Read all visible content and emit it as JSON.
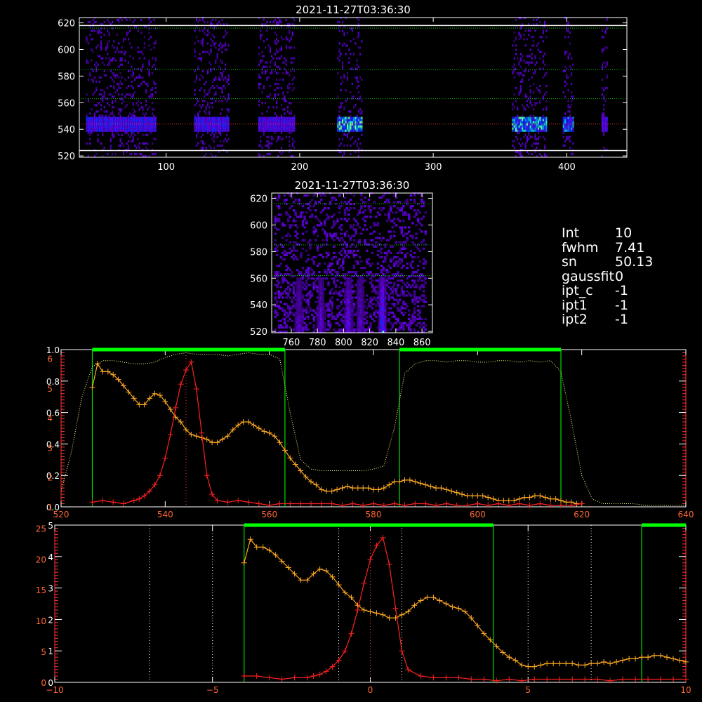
{
  "info_panel": {
    "rows": [
      {
        "key": "Int",
        "value": "10"
      },
      {
        "key": "fwhm",
        "value": "7.41"
      },
      {
        "key": "sn",
        "value": "50.13"
      },
      {
        "key": "gaussfit",
        "value": "0"
      },
      {
        "key": "ipt_c",
        "value": "-1"
      },
      {
        "key": "ipt1",
        "value": "-1"
      },
      {
        "key": "ipt2",
        "value": "-1"
      }
    ]
  },
  "colors": {
    "background": "#000000",
    "axes": "#ffffff",
    "line_yellow": "#ffaa22",
    "line_red": "#ff2020",
    "green": "#00ff00",
    "dotted_white": "#ffffff"
  },
  "chart_data": [
    {
      "id": "top-image",
      "type": "heatmap",
      "title": "2021-11-27T03:36:30",
      "xlim": [
        35,
        445
      ],
      "ylim": [
        519,
        624
      ],
      "xticks": [
        100,
        200,
        300,
        400
      ],
      "yticks": [
        520,
        540,
        560,
        580,
        600,
        620
      ],
      "hlines_dotted": [
        {
          "y": 616,
          "color": "#00cc00"
        },
        {
          "y": 585,
          "color": "#00cc00"
        },
        {
          "y": 563,
          "color": "#00cc00"
        },
        {
          "y": 544,
          "color": "#ff3333"
        }
      ],
      "hlines_solid": [
        618,
        524
      ],
      "bright_rows": [
        538,
        548
      ],
      "segments": [
        {
          "x0": 40,
          "x1": 92,
          "strength": 0.6
        },
        {
          "x0": 121,
          "x1": 147,
          "strength": 0.6
        },
        {
          "x0": 169,
          "x1": 196,
          "strength": 0.55
        },
        {
          "x0": 228,
          "x1": 247,
          "strength": 0.95
        },
        {
          "x0": 359,
          "x1": 385,
          "strength": 0.9
        },
        {
          "x0": 397,
          "x1": 405,
          "strength": 0.8
        },
        {
          "x0": 426,
          "x1": 430,
          "strength": 0.5
        }
      ]
    },
    {
      "id": "mid-image",
      "type": "heatmap",
      "title": "2021-11-27T03:36:30",
      "xlim": [
        745,
        868
      ],
      "ylim": [
        519,
        624
      ],
      "xticks": [
        760,
        780,
        800,
        820,
        840,
        860
      ],
      "yticks": [
        520,
        540,
        560,
        580,
        600,
        620
      ],
      "hlines_dotted": [
        {
          "y": 616,
          "color": "#00cc00"
        },
        {
          "y": 585,
          "color": "#00cc00"
        },
        {
          "y": 562,
          "color": "#00cc00"
        }
      ],
      "data_x_range": [
        747,
        862
      ],
      "bright_columns": [
        {
          "x": 765,
          "strength": 0.4
        },
        {
          "x": 782,
          "strength": 0.45
        },
        {
          "x": 803,
          "strength": 0.6
        },
        {
          "x": 812,
          "strength": 0.5
        },
        {
          "x": 829,
          "strength": 1.0
        }
      ]
    },
    {
      "id": "spectrum-wavelength",
      "type": "line",
      "xlim": [
        520,
        640
      ],
      "xticks": [
        520,
        540,
        560,
        580,
        600,
        620,
        640
      ],
      "left_ticks_white": [
        0.0,
        0.2,
        0.4,
        0.6,
        0.8,
        1.0
      ],
      "left_ticks_orange": [
        1,
        2,
        3,
        4,
        5,
        6
      ],
      "green_bars": [
        [
          526,
          563
        ],
        [
          585,
          616
        ]
      ],
      "vline_dotted_red": 544,
      "series": [
        {
          "color": "#ffaa22",
          "x": [
            526,
            527,
            528,
            529,
            530,
            531,
            532,
            533,
            534,
            535,
            536,
            537,
            538,
            539,
            540,
            541,
            542,
            543,
            544,
            545,
            546,
            547,
            548,
            549,
            550,
            551,
            552,
            553,
            554,
            555,
            556,
            557,
            558,
            559,
            560,
            561,
            562,
            563,
            564,
            565,
            566,
            567,
            568,
            569,
            570,
            571,
            572,
            573,
            574,
            575,
            576,
            577,
            578,
            579,
            580,
            581,
            582,
            583,
            584,
            585,
            586,
            587,
            588,
            589,
            590,
            591,
            592,
            593,
            594,
            595,
            596,
            597,
            598,
            599,
            600,
            601,
            602,
            603,
            604,
            605,
            606,
            607,
            608,
            609,
            610,
            611,
            612,
            613,
            614,
            615,
            616,
            617,
            618,
            619,
            620
          ],
          "y": [
            0.76,
            0.91,
            0.86,
            0.86,
            0.84,
            0.81,
            0.77,
            0.73,
            0.69,
            0.65,
            0.65,
            0.69,
            0.72,
            0.71,
            0.67,
            0.62,
            0.57,
            0.54,
            0.49,
            0.46,
            0.45,
            0.44,
            0.43,
            0.41,
            0.41,
            0.43,
            0.45,
            0.49,
            0.52,
            0.54,
            0.54,
            0.52,
            0.5,
            0.48,
            0.47,
            0.45,
            0.41,
            0.36,
            0.31,
            0.27,
            0.23,
            0.19,
            0.16,
            0.14,
            0.11,
            0.1,
            0.1,
            0.11,
            0.12,
            0.13,
            0.12,
            0.12,
            0.12,
            0.12,
            0.11,
            0.11,
            0.12,
            0.14,
            0.16,
            0.16,
            0.17,
            0.17,
            0.16,
            0.15,
            0.14,
            0.13,
            0.12,
            0.12,
            0.11,
            0.1,
            0.09,
            0.08,
            0.07,
            0.07,
            0.07,
            0.07,
            0.06,
            0.05,
            0.04,
            0.04,
            0.04,
            0.04,
            0.05,
            0.06,
            0.06,
            0.07,
            0.07,
            0.06,
            0.05,
            0.05,
            0.04,
            0.03,
            0.03,
            0.02,
            0.02
          ]
        },
        {
          "color": "#ff2020",
          "x": [
            526,
            528,
            530,
            532,
            534,
            535,
            536,
            537,
            538,
            539,
            540,
            541,
            542,
            543,
            544,
            545,
            546,
            547,
            548,
            549,
            550,
            552,
            554,
            556,
            558,
            560,
            562,
            564,
            566,
            568,
            570,
            572,
            574,
            576,
            578,
            580,
            582,
            584,
            586,
            588,
            590,
            592,
            594,
            596,
            598,
            600,
            602,
            604,
            606,
            608,
            610,
            612,
            614,
            616,
            618,
            620
          ],
          "y": [
            0.03,
            0.04,
            0.03,
            0.02,
            0.04,
            0.05,
            0.07,
            0.1,
            0.14,
            0.2,
            0.31,
            0.46,
            0.63,
            0.78,
            0.87,
            0.92,
            0.75,
            0.47,
            0.2,
            0.08,
            0.04,
            0.03,
            0.04,
            0.03,
            0.02,
            0.01,
            0.02,
            0.02,
            0.02,
            0.02,
            0.02,
            0.02,
            0.01,
            0.02,
            0.01,
            0.02,
            0.01,
            0.02,
            0.01,
            0.02,
            0.02,
            0.01,
            0.02,
            0.01,
            0.01,
            0.02,
            0.01,
            0.02,
            0.01,
            0.02,
            0.01,
            0.02,
            0.01,
            0.01,
            0.01,
            0.02
          ]
        },
        {
          "color": "#ffff88",
          "style": "dotted",
          "x": [
            520,
            522,
            524,
            526,
            528,
            530,
            532,
            534,
            536,
            538,
            540,
            542,
            544,
            546,
            548,
            550,
            552,
            554,
            556,
            558,
            560,
            562,
            564,
            566,
            568,
            570,
            572,
            574,
            576,
            578,
            580,
            582,
            584,
            586,
            588,
            590,
            592,
            594,
            596,
            598,
            600,
            602,
            604,
            606,
            608,
            610,
            612,
            614,
            616,
            618,
            620,
            622,
            624,
            626,
            628,
            630,
            632,
            634,
            636,
            638,
            640
          ],
          "y": [
            0.1,
            0.35,
            0.7,
            0.89,
            0.93,
            0.93,
            0.92,
            0.91,
            0.91,
            0.92,
            0.95,
            0.97,
            0.98,
            0.97,
            0.97,
            0.97,
            0.96,
            0.97,
            0.98,
            0.97,
            0.97,
            0.94,
            0.6,
            0.3,
            0.24,
            0.23,
            0.23,
            0.23,
            0.23,
            0.23,
            0.24,
            0.26,
            0.5,
            0.85,
            0.91,
            0.93,
            0.93,
            0.92,
            0.93,
            0.93,
            0.92,
            0.92,
            0.93,
            0.93,
            0.92,
            0.93,
            0.92,
            0.93,
            0.86,
            0.55,
            0.2,
            0.05,
            0.02,
            0.02,
            0.02,
            0.02,
            0.01,
            0.01,
            0.01,
            0.01,
            0.01
          ]
        }
      ]
    },
    {
      "id": "spectrum-offset",
      "type": "line",
      "xlim": [
        -10,
        10
      ],
      "xticks": [
        -10,
        -5,
        0,
        5,
        10
      ],
      "left_ticks_white": [
        0,
        1,
        2,
        3,
        4,
        5
      ],
      "left_ticks_orange": [
        0,
        5,
        10,
        15,
        20,
        25
      ],
      "green_bars": [
        [
          -4.0,
          3.9
        ],
        [
          8.6,
          10
        ]
      ],
      "vlines_dotted_white": [
        -7,
        -5,
        -1,
        1,
        5,
        7
      ],
      "vline_dotted_red": 0,
      "series": [
        {
          "color": "#ffaa22",
          "x": [
            -4.0,
            -3.8,
            -3.6,
            -3.4,
            -3.2,
            -3.0,
            -2.8,
            -2.6,
            -2.4,
            -2.2,
            -2.0,
            -1.8,
            -1.6,
            -1.4,
            -1.2,
            -1.0,
            -0.8,
            -0.6,
            -0.4,
            -0.2,
            0.0,
            0.2,
            0.4,
            0.6,
            0.8,
            1.0,
            1.2,
            1.4,
            1.6,
            1.8,
            2.0,
            2.2,
            2.4,
            2.6,
            2.8,
            3.0,
            3.2,
            3.4,
            3.6,
            3.8,
            4.0,
            4.2,
            4.4,
            4.6,
            4.8,
            5.0,
            5.2,
            5.4,
            5.6,
            5.8,
            6.0,
            6.2,
            6.4,
            6.6,
            6.8,
            7.0,
            7.2,
            7.4,
            7.6,
            7.8,
            8.0,
            8.2,
            8.4,
            8.6,
            8.8,
            9.0,
            9.2,
            9.4,
            9.6,
            9.8,
            10.0
          ],
          "y": [
            0.76,
            0.91,
            0.86,
            0.86,
            0.84,
            0.81,
            0.77,
            0.73,
            0.69,
            0.65,
            0.65,
            0.69,
            0.72,
            0.71,
            0.67,
            0.62,
            0.57,
            0.54,
            0.49,
            0.46,
            0.45,
            0.44,
            0.43,
            0.41,
            0.41,
            0.43,
            0.45,
            0.49,
            0.52,
            0.54,
            0.54,
            0.52,
            0.5,
            0.48,
            0.47,
            0.45,
            0.41,
            0.36,
            0.31,
            0.27,
            0.23,
            0.19,
            0.16,
            0.14,
            0.11,
            0.1,
            0.1,
            0.11,
            0.12,
            0.12,
            0.12,
            0.12,
            0.12,
            0.11,
            0.11,
            0.12,
            0.12,
            0.13,
            0.12,
            0.13,
            0.14,
            0.15,
            0.15,
            0.16,
            0.16,
            0.17,
            0.17,
            0.16,
            0.15,
            0.14,
            0.13
          ]
        },
        {
          "color": "#ff2020",
          "x": [
            -4.0,
            -3.6,
            -3.2,
            -2.8,
            -2.4,
            -2.0,
            -1.8,
            -1.6,
            -1.4,
            -1.2,
            -1.0,
            -0.8,
            -0.6,
            -0.4,
            -0.2,
            0.0,
            0.2,
            0.4,
            0.6,
            0.8,
            1.0,
            1.2,
            1.6,
            2.0,
            2.4,
            2.8,
            3.2,
            3.6,
            4.0,
            4.4,
            4.8,
            5.2,
            5.6,
            6.0,
            6.4,
            6.8,
            7.2,
            7.6,
            8.0,
            8.4,
            8.8,
            9.2,
            9.6,
            10.0
          ],
          "y": [
            0.04,
            0.04,
            0.03,
            0.02,
            0.03,
            0.03,
            0.04,
            0.05,
            0.07,
            0.1,
            0.14,
            0.2,
            0.31,
            0.46,
            0.63,
            0.78,
            0.87,
            0.92,
            0.75,
            0.47,
            0.2,
            0.08,
            0.04,
            0.03,
            0.03,
            0.03,
            0.02,
            0.02,
            0.01,
            0.02,
            0.01,
            0.02,
            0.02,
            0.02,
            0.02,
            0.02,
            0.02,
            0.01,
            0.02,
            0.02,
            0.02,
            0.02,
            0.02,
            0.02
          ]
        }
      ]
    }
  ]
}
